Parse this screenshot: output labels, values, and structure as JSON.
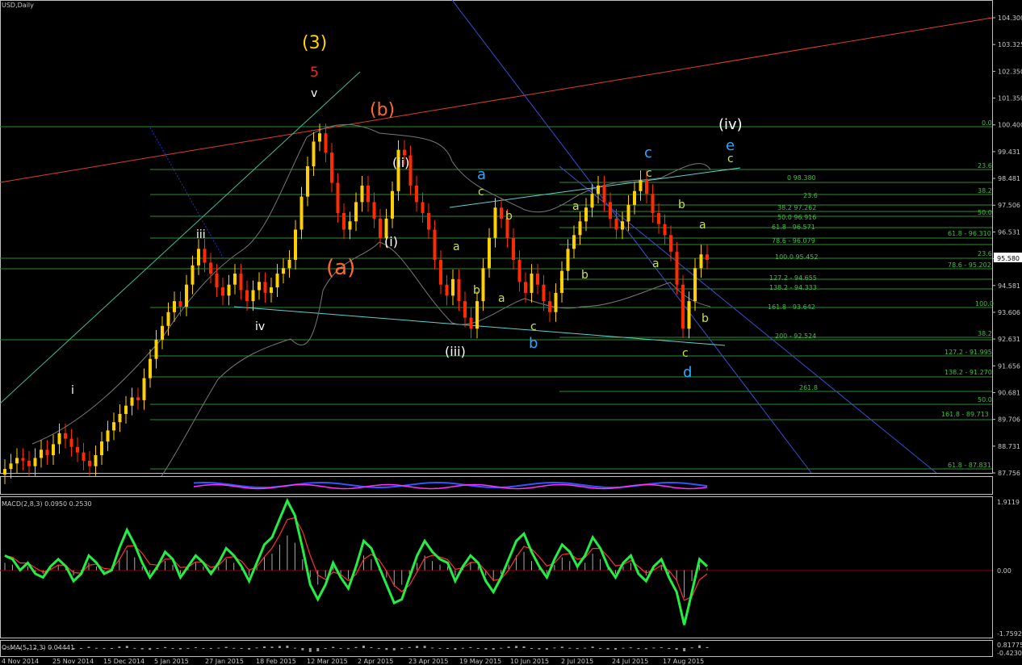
{
  "chart_data": {
    "type": "line",
    "title": "USD,Daily",
    "main_panel": {
      "price_axis_ticks": [
        "104.300",
        "103.325",
        "102.350",
        "101.350",
        "100.400",
        "99.431",
        "98.481",
        "97.506",
        "96.531",
        "95.556",
        "94.581",
        "93.606",
        "92.631",
        "91.656",
        "90.681",
        "89.706",
        "88.731",
        "87.756"
      ],
      "current_price": "95.580",
      "date_ticks": [
        "4 Nov 2014",
        "25 Nov 2014",
        "15 Dec 2014",
        "5 Jan 2015",
        "27 Jan 2015",
        "18 Feb 2015",
        "12 Mar 2015",
        "2 Apr 2015",
        "23 Apr 2015",
        "19 May 2015",
        "10 Jun 2015",
        "2 Jul 2015",
        "24 Jul 2015",
        "17 Aug 2015"
      ],
      "fib_labels_left": [
        "0.0",
        "23.6",
        "38.2",
        "50.0",
        "61.8 - 96.310",
        "23.6",
        "100.0",
        "38.2"
      ],
      "fib_labels_center": [
        "0 98.380",
        "23.6",
        "38.2 97.262",
        "50.0 96.916",
        "61.8 - 96.571",
        "78.6 - 96.079",
        "100.0 95.452",
        "127.2 - 94.655",
        "138.2 - 94.333",
        "161.8 - 93.642",
        "200 - 92.524",
        "261.8"
      ],
      "fib_labels_right": [
        "0.0",
        "23.6",
        "38.2",
        "50.0",
        "61.8 - 96.310",
        "23.6",
        "78.6 - 95.202",
        "100.0",
        "38.2",
        "127.2 - 91.995",
        "138.2 - 91.270",
        "50.0",
        "161.8 - 89.713",
        "61.8 - 87.831"
      ],
      "wave_labels": {
        "w3_big": "(3)",
        "w5_red": "5",
        "w_v": "v",
        "wb_orange": "(b)",
        "wa_orange": "(a)",
        "w_ii": "(ii)",
        "w_i": "(i)",
        "w_iii": "(iii)",
        "w_iv_big": "(iv)",
        "w_iii_small": "iii",
        "w_iv_small": "iv",
        "w_i_small": "i",
        "blue_a": "a",
        "blue_b": "b",
        "blue_c": "c",
        "blue_d": "d",
        "blue_e": "e",
        "yg_c1": "c",
        "yg_b1": "b",
        "yg_a1": "a",
        "yg_b2": "b",
        "yg_a2": "a",
        "yg_c2": "c",
        "yg_a3": "a",
        "yg_b3": "b",
        "yg_c3": "c",
        "yg_b4": "b",
        "yg_a4": "a",
        "yg_a5": "a",
        "yg_b5": "b",
        "yg_c4": "c",
        "yg_c5": "c"
      }
    },
    "subpanel1": {
      "label": ""
    },
    "macd": {
      "label": "MACD(2,8,3) 0.0950 0.2530",
      "axis_ticks": [
        "1.9119",
        "0.00",
        "-1.7592"
      ],
      "range": [
        -1.7592,
        1.9119
      ]
    },
    "osma": {
      "label": "OsMA(5,12,3) 0.04441",
      "axis_ticks": [
        "0.81775",
        "0.00",
        "-0.4230"
      ]
    },
    "price_series": [
      87.9,
      88.1,
      88.3,
      88.2,
      88.0,
      88.3,
      88.6,
      88.4,
      88.8,
      89.2,
      89.0,
      88.7,
      88.5,
      88.2,
      88.0,
      88.4,
      88.9,
      89.3,
      89.6,
      89.9,
      90.2,
      90.5,
      90.4,
      91.2,
      91.9,
      92.6,
      93.1,
      93.6,
      94.0,
      93.8,
      94.6,
      95.3,
      95.9,
      95.4,
      95.0,
      94.5,
      94.2,
      94.6,
      95.0,
      94.4,
      94.0,
      94.4,
      94.7,
      94.3,
      94.5,
      95.0,
      95.2,
      95.5,
      96.6,
      97.8,
      98.9,
      99.8,
      100.1,
      99.4,
      98.3,
      97.2,
      96.6,
      96.9,
      97.6,
      98.2,
      97.6,
      97.0,
      96.3,
      97.0,
      98.0,
      99.5,
      99.3,
      98.2,
      97.6,
      97.2,
      96.6,
      95.5,
      94.6,
      94.2,
      94.8,
      94.0,
      93.4,
      93.0,
      94.0,
      95.2,
      96.3,
      97.4,
      97.0,
      96.3,
      95.5,
      94.7,
      94.3,
      95.0,
      94.6,
      94.0,
      93.6,
      94.3,
      95.1,
      95.9,
      96.4,
      96.9,
      97.4,
      97.9,
      98.2,
      97.6,
      97.0,
      96.6,
      96.9,
      97.5,
      98.0,
      98.4,
      97.9,
      97.2,
      96.8,
      96.4,
      95.8,
      94.6,
      93.0,
      94.0,
      95.2,
      95.7,
      95.5
    ],
    "macd_series": [
      0.4,
      0.3,
      0.0,
      0.2,
      -0.1,
      -0.2,
      0.1,
      0.3,
      0.1,
      -0.3,
      -0.1,
      0.4,
      0.2,
      -0.1,
      0.0,
      0.6,
      1.1,
      0.7,
      0.2,
      -0.2,
      0.1,
      0.5,
      0.3,
      -0.2,
      0.1,
      0.4,
      0.2,
      -0.1,
      0.2,
      0.6,
      0.4,
      0.1,
      -0.3,
      0.2,
      0.7,
      0.9,
      1.4,
      1.9,
      1.5,
      0.6,
      -0.4,
      -0.8,
      -0.4,
      0.2,
      -0.2,
      -0.5,
      0.1,
      0.8,
      0.6,
      0.1,
      -0.4,
      -0.9,
      -0.8,
      -0.2,
      0.4,
      0.8,
      0.5,
      0.3,
      0.2,
      -0.3,
      0.1,
      0.4,
      0.2,
      -0.3,
      -0.6,
      -0.2,
      0.3,
      0.8,
      1.0,
      0.5,
      0.1,
      -0.2,
      0.3,
      0.7,
      0.5,
      0.1,
      0.4,
      0.9,
      0.6,
      0.1,
      -0.2,
      0.2,
      0.4,
      -0.1,
      -0.3,
      0.1,
      0.3,
      -0.2,
      -0.6,
      -1.5,
      -0.6,
      0.3,
      0.1
    ]
  }
}
